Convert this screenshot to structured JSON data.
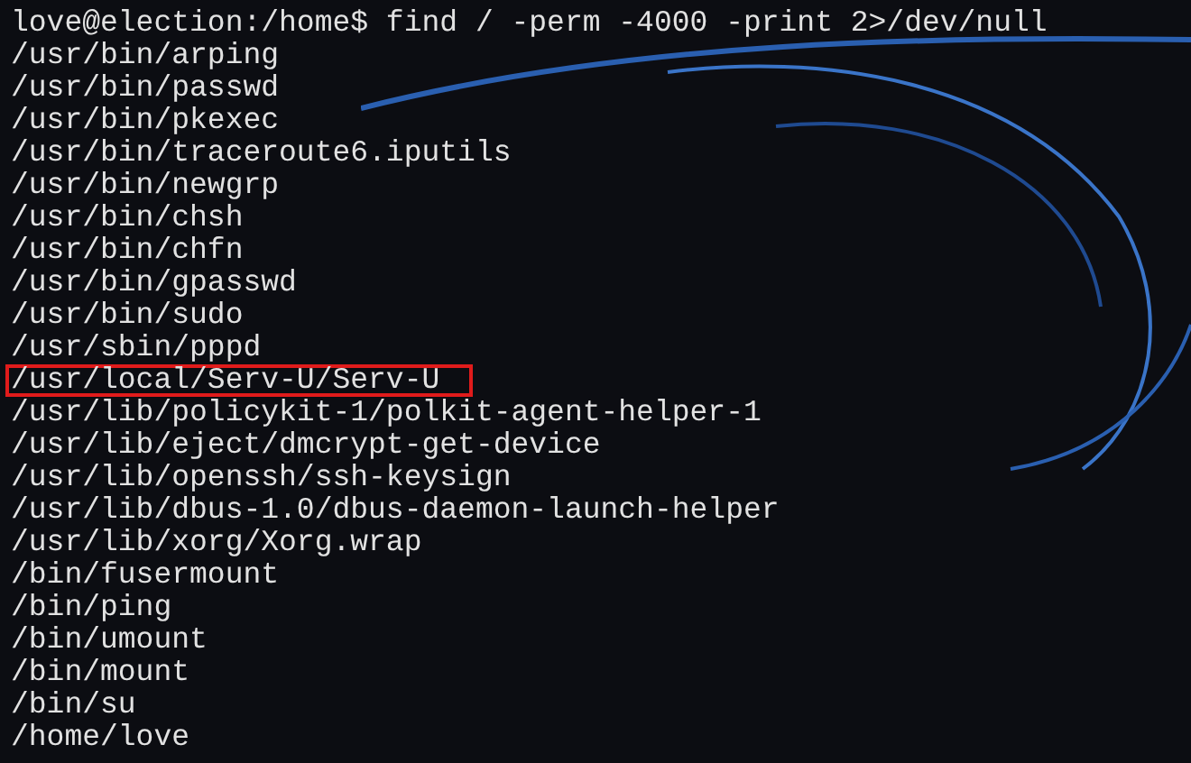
{
  "terminal": {
    "lines": [
      {
        "text": "love@election:/home$ find / -perm -4000 -print 2>/dev/null",
        "highlighted": false
      },
      {
        "text": "/usr/bin/arping",
        "highlighted": false
      },
      {
        "text": "/usr/bin/passwd",
        "highlighted": false
      },
      {
        "text": "/usr/bin/pkexec",
        "highlighted": false
      },
      {
        "text": "/usr/bin/traceroute6.iputils",
        "highlighted": false
      },
      {
        "text": "/usr/bin/newgrp",
        "highlighted": false
      },
      {
        "text": "/usr/bin/chsh",
        "highlighted": false
      },
      {
        "text": "/usr/bin/chfn",
        "highlighted": false
      },
      {
        "text": "/usr/bin/gpasswd",
        "highlighted": false
      },
      {
        "text": "/usr/bin/sudo",
        "highlighted": false
      },
      {
        "text": "/usr/sbin/pppd",
        "highlighted": false
      },
      {
        "text": "/usr/local/Serv-U/Serv-U",
        "highlighted": true
      },
      {
        "text": "/usr/lib/policykit-1/polkit-agent-helper-1",
        "highlighted": false
      },
      {
        "text": "/usr/lib/eject/dmcrypt-get-device",
        "highlighted": false
      },
      {
        "text": "/usr/lib/openssh/ssh-keysign",
        "highlighted": false
      },
      {
        "text": "/usr/lib/dbus-1.0/dbus-daemon-launch-helper",
        "highlighted": false
      },
      {
        "text": "/usr/lib/xorg/Xorg.wrap",
        "highlighted": false
      },
      {
        "text": "/bin/fusermount",
        "highlighted": false
      },
      {
        "text": "/bin/ping",
        "highlighted": false
      },
      {
        "text": "/bin/umount",
        "highlighted": false
      },
      {
        "text": "/bin/mount",
        "highlighted": false
      },
      {
        "text": "/bin/su",
        "highlighted": false
      },
      {
        "text": "/home/love",
        "highlighted": false
      }
    ]
  }
}
